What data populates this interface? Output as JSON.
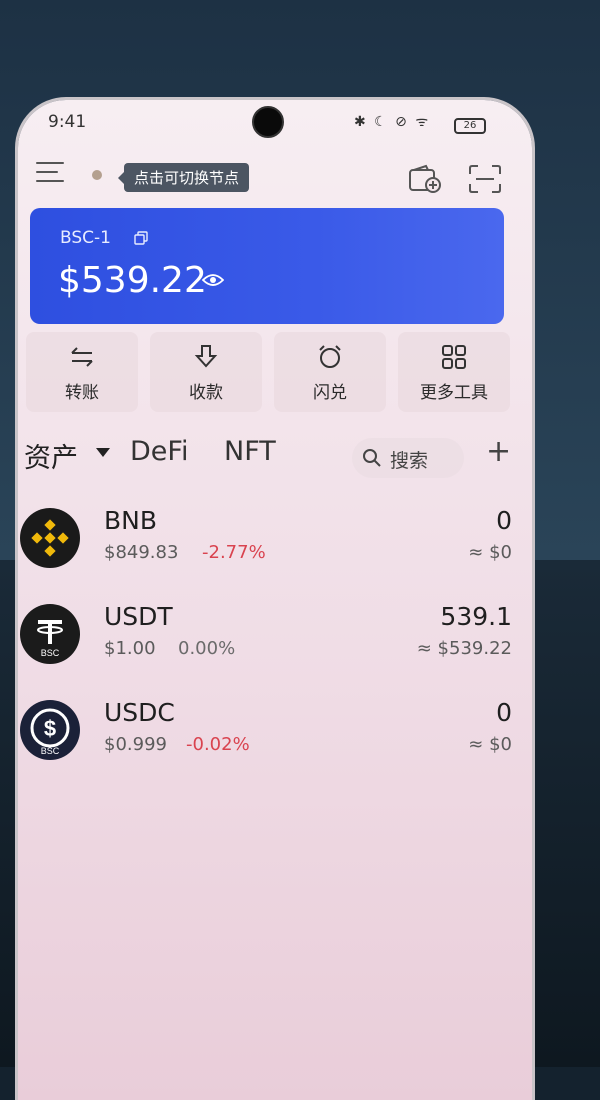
{
  "status_bar": {
    "time": "9:41",
    "icons": "✱ ☾ ⊘ ᯤ",
    "battery": "26"
  },
  "header": {
    "node_tooltip": "点击可切换节点"
  },
  "wallet_card": {
    "chain": "BSC-1",
    "balance": "$539.22",
    "accent": "#2f4fe0"
  },
  "actions": [
    {
      "label": "转账",
      "icon": "transfer-icon"
    },
    {
      "label": "收款",
      "icon": "receive-icon"
    },
    {
      "label": "闪兑",
      "icon": "swap-icon"
    },
    {
      "label": "更多工具",
      "icon": "more-tools-icon"
    }
  ],
  "tabs": {
    "assets": "资产",
    "defi": "DeFi",
    "nft": "NFT",
    "search": "搜索",
    "add": "+"
  },
  "assets": [
    {
      "name": "BNB",
      "price": "$849.83",
      "change": "-2.77%",
      "amount": "0",
      "value": "≈ $0"
    },
    {
      "name": "USDT",
      "price": "$1.00",
      "change": "0.00%",
      "amount": "539.1",
      "value": "≈ $539.22",
      "badge": "BSC"
    },
    {
      "name": "USDC",
      "price": "$0.999",
      "change": "-0.02%",
      "amount": "0",
      "value": "≈ $0",
      "badge": "BSC"
    }
  ],
  "colors": {
    "negative": "#d9434f",
    "card_blue": "#2f4fe0"
  }
}
